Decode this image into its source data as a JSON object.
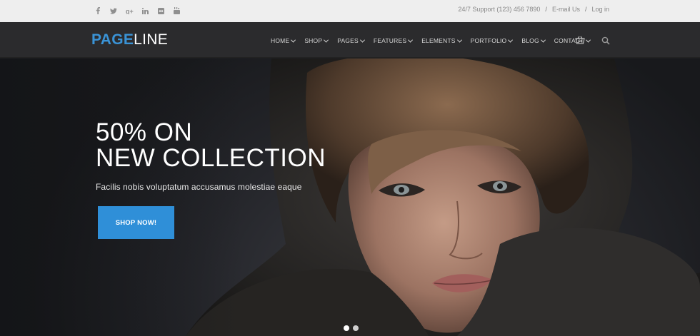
{
  "topbar": {
    "social_icons": [
      "facebook-icon",
      "twitter-icon",
      "google-plus-icon",
      "linkedin-icon",
      "flickr-icon",
      "youtube-icon"
    ],
    "support_text": "24/7 Support (123) 456 7890",
    "separator": "/",
    "email_link": "E-mail Us",
    "login_link": "Log in"
  },
  "nav": {
    "logo_part1": "PAGE",
    "logo_part2": "LINE",
    "items": [
      {
        "label": "HOME"
      },
      {
        "label": "SHOP"
      },
      {
        "label": "PAGES"
      },
      {
        "label": "FEATURES"
      },
      {
        "label": "ELEMENTS"
      },
      {
        "label": "PORTFOLIO"
      },
      {
        "label": "BLOG"
      },
      {
        "label": "CONTACT"
      }
    ],
    "icons": [
      "cart-icon",
      "search-icon"
    ]
  },
  "hero": {
    "headline_line1": "50% ON",
    "headline_line2": "NEW COLLECTION",
    "subtext": "Facilis nobis voluptatum accusamus molestiae eaque",
    "button_label": "SHOP NOW!",
    "slides": 2,
    "active_slide": 1
  },
  "colors": {
    "brand_blue": "#2f8fd8",
    "topbar_bg": "#eeeeee",
    "navbar_bg": "#2b2b2d"
  }
}
